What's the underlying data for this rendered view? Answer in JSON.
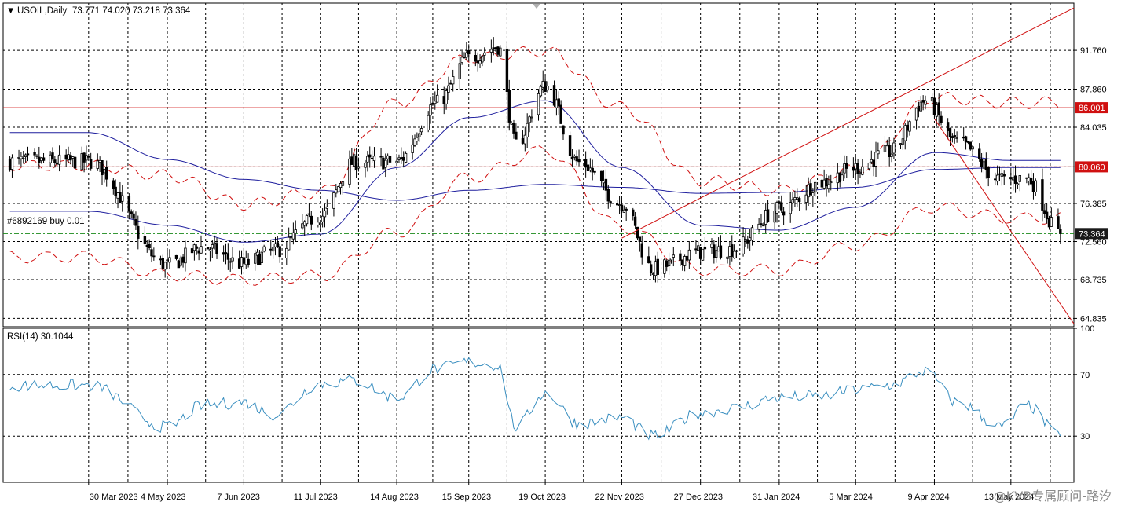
{
  "header": {
    "arrow": "▼",
    "title": "USOIL,Daily",
    "ohlc": "73.771 74.020 73.218 73.364"
  },
  "rsi_header": "RSI(14) 30.1044",
  "object_label": "#6892169 buy 0.01",
  "watermark": "@KVB专属顾问-路汐",
  "colors": {
    "bull_candle": "#000000",
    "bear_candle": "#000000",
    "ma": "#1f1f9e",
    "bands": "#d01010",
    "levels": "#d01010",
    "rsi": "#3a8fc0",
    "price_marker": "#1a1a1a",
    "entry_line": "#1a8a1a"
  },
  "chart_data": [
    {
      "type": "line",
      "panel": "price",
      "symbol": "USOIL",
      "timeframe": "Daily",
      "y_ticks": [
        "91.760",
        "87.860",
        "84.035",
        "80.060",
        "76.385",
        "72.560",
        "68.735",
        "64.835"
      ],
      "ylim": [
        64.0,
        96.5
      ],
      "x_ticks": [
        "30 Mar 2023",
        "4 May 2023",
        "7 Jun 2023",
        "11 Jul 2023",
        "14 Aug 2023",
        "15 Sep 2023",
        "19 Oct 2023",
        "22 Nov 2023",
        "27 Dec 2023",
        "31 Jan 2024",
        "5 Mar 2024",
        "9 Apr 2024",
        "13 May 2024"
      ],
      "horizontal_levels": [
        {
          "label": "86.001",
          "value": 86.001
        },
        {
          "label": "80.060",
          "value": 80.06
        }
      ],
      "current_price": {
        "label": "73.364",
        "value": 73.364
      },
      "entry_line": 73.36,
      "trendlines": [
        {
          "from": [
            "22 Nov 2023",
            72.9
          ],
          "to": [
            "13 May 2024",
            92.8
          ]
        },
        {
          "from": [
            "9 Apr 2024",
            84.9
          ],
          "to": [
            "13 May 2024",
            73.6
          ]
        }
      ],
      "close_anchors": [
        [
          "30 Mar 2023",
          80.6
        ],
        [
          "4 May 2023",
          70.2
        ],
        [
          "20 May 2023",
          72.0
        ],
        [
          "7 Jun 2023",
          70.3
        ],
        [
          "20 Jun 2023",
          71.6
        ],
        [
          "11 Jul 2023",
          75.1
        ],
        [
          "26 Jul 2023",
          80.5
        ],
        [
          "14 Aug 2023",
          80.6
        ],
        [
          "1 Sep 2023",
          86.5
        ],
        [
          "15 Sep 2023",
          91.0
        ],
        [
          "28 Sep 2023",
          92.1
        ],
        [
          "6 Oct 2023",
          82.3
        ],
        [
          "19 Oct 2023",
          88.2
        ],
        [
          "3 Nov 2023",
          80.5
        ],
        [
          "22 Nov 2023",
          76.4
        ],
        [
          "6 Dec 2023",
          69.8
        ],
        [
          "27 Dec 2023",
          71.5
        ],
        [
          "10 Jan 2024",
          71.8
        ],
        [
          "31 Jan 2024",
          75.8
        ],
        [
          "19 Feb 2024",
          78.5
        ],
        [
          "5 Mar 2024",
          80.0
        ],
        [
          "20 Mar 2024",
          81.5
        ],
        [
          "5 Apr 2024",
          86.7
        ],
        [
          "19 Apr 2024",
          82.5
        ],
        [
          "9 May 2024",
          78.8
        ],
        [
          "20 May 2024",
          78.9
        ],
        [
          "4 Jun 2024",
          73.4
        ]
      ],
      "ma_fast_anchors": [
        [
          "30 Mar 2023",
          75.6
        ],
        [
          "4 May 2023",
          74.2
        ],
        [
          "7 Jun 2023",
          72.5
        ],
        [
          "11 Jul 2023",
          73.3
        ],
        [
          "14 Aug 2023",
          80.0
        ],
        [
          "15 Sep 2023",
          85.0
        ],
        [
          "19 Oct 2023",
          86.7
        ],
        [
          "22 Nov 2023",
          80.0
        ],
        [
          "27 Dec 2023",
          74.2
        ],
        [
          "31 Jan 2024",
          73.7
        ],
        [
          "5 Mar 2024",
          76.0
        ],
        [
          "9 Apr 2024",
          81.5
        ],
        [
          "13 May 2024",
          80.7
        ]
      ],
      "ma_slow_anchors": [
        [
          "30 Mar 2023",
          83.5
        ],
        [
          "4 May 2023",
          80.8
        ],
        [
          "7 Jun 2023",
          78.8
        ],
        [
          "11 Jul 2023",
          77.7
        ],
        [
          "14 Aug 2023",
          76.7
        ],
        [
          "15 Sep 2023",
          77.7
        ],
        [
          "19 Oct 2023",
          78.3
        ],
        [
          "22 Nov 2023",
          78.0
        ],
        [
          "27 Dec 2023",
          77.4
        ],
        [
          "31 Jan 2024",
          77.5
        ],
        [
          "5 Mar 2024",
          78.0
        ],
        [
          "9 Apr 2024",
          79.8
        ],
        [
          "13 May 2024",
          80.0
        ]
      ],
      "band_width_anchors": [
        [
          "30 Mar 2023",
          4.6
        ],
        [
          "4 May 2023",
          5.0
        ],
        [
          "7 Jun 2023",
          3.8
        ],
        [
          "11 Jul 2023",
          4.2
        ],
        [
          "14 Aug 2023",
          6.5
        ],
        [
          "15 Sep 2023",
          6.0
        ],
        [
          "19 Oct 2023",
          5.0
        ],
        [
          "22 Nov 2023",
          6.0
        ],
        [
          "27 Dec 2023",
          4.5
        ],
        [
          "31 Jan 2024",
          4.0
        ],
        [
          "5 Mar 2024",
          3.8
        ],
        [
          "9 Apr 2024",
          5.5
        ],
        [
          "13 May 2024",
          5.8
        ]
      ]
    },
    {
      "type": "line",
      "panel": "rsi",
      "name": "RSI(14)",
      "y_ticks": [
        "100",
        "70",
        "30"
      ],
      "ylim": [
        0,
        100
      ],
      "last_value": 30.1044,
      "anchors": [
        [
          "30 Mar 2023",
          63
        ],
        [
          "4 May 2023",
          36
        ],
        [
          "20 May 2023",
          50
        ],
        [
          "7 Jun 2023",
          52
        ],
        [
          "20 Jun 2023",
          44
        ],
        [
          "11 Jul 2023",
          64
        ],
        [
          "26 Jul 2023",
          66
        ],
        [
          "14 Aug 2023",
          55
        ],
        [
          "1 Sep 2023",
          74
        ],
        [
          "15 Sep 2023",
          78
        ],
        [
          "28 Sep 2023",
          76
        ],
        [
          "6 Oct 2023",
          36
        ],
        [
          "19 Oct 2023",
          58
        ],
        [
          "3 Nov 2023",
          38
        ],
        [
          "22 Nov 2023",
          42
        ],
        [
          "6 Dec 2023",
          30
        ],
        [
          "27 Dec 2023",
          45
        ],
        [
          "10 Jan 2024",
          48
        ],
        [
          "31 Jan 2024",
          55
        ],
        [
          "19 Feb 2024",
          56
        ],
        [
          "5 Mar 2024",
          60
        ],
        [
          "20 Mar 2024",
          63
        ],
        [
          "5 Apr 2024",
          72
        ],
        [
          "19 Apr 2024",
          52
        ],
        [
          "9 May 2024",
          36
        ],
        [
          "20 May 2024",
          50
        ],
        [
          "4 Jun 2024",
          30.1
        ]
      ]
    }
  ]
}
